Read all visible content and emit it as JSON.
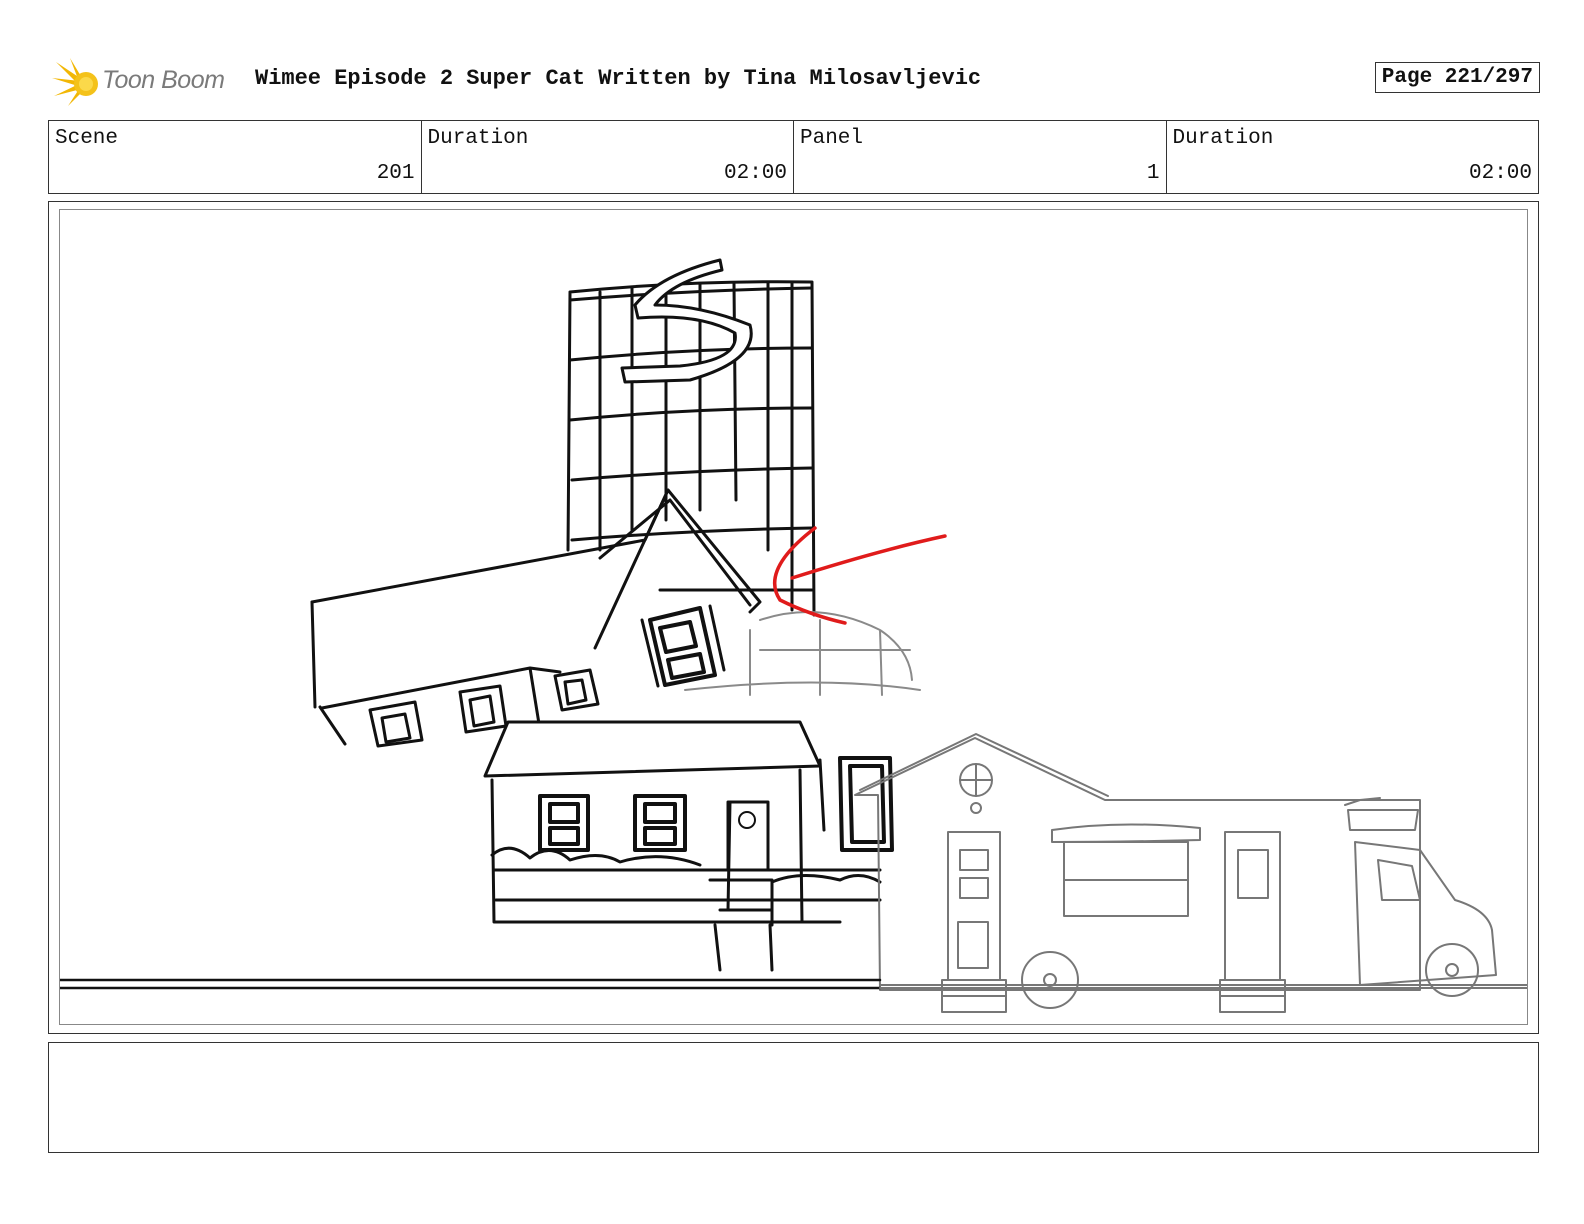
{
  "header": {
    "logo_text": "Toon Boom",
    "title": "Wimee Episode 2 Super Cat  Written by Tina Milosavljevic",
    "page": "Page 221/297"
  },
  "info": {
    "scene_label": "Scene",
    "scene_value": "201",
    "scene_duration_label": "Duration",
    "scene_duration_value": "02:00",
    "panel_label": "Panel",
    "panel_value": "1",
    "panel_duration_label": "Duration",
    "panel_duration_value": "02:00"
  },
  "notes": {
    "text": ""
  },
  "colors": {
    "logo_accent": "#f2b705",
    "annotation": "#e01b1b",
    "sketch": "#111111",
    "faint_sketch": "#8a8a8a"
  }
}
